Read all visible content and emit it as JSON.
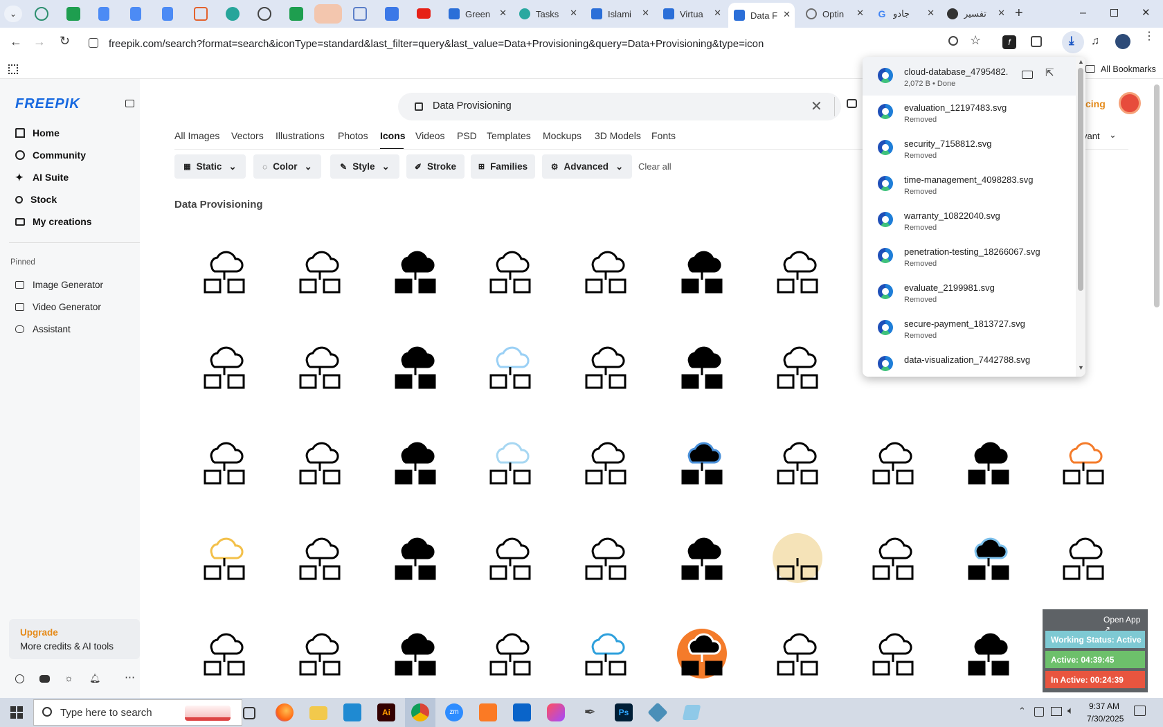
{
  "browser": {
    "tabs": [
      {
        "label": "Green",
        "color": "#2b6fd8"
      },
      {
        "label": "Tasks",
        "color": "#2aa8a0"
      },
      {
        "label": "Islami",
        "color": "#2b6fd8"
      },
      {
        "label": "Virtua",
        "color": "#2b6fd8"
      },
      {
        "label": "Data F",
        "color": "#2b6fd8",
        "active": true
      },
      {
        "label": "Optin",
        "color": "#6d6d6d"
      },
      {
        "label": "جادو",
        "color": "#4285f4"
      },
      {
        "label": "تفسير",
        "color": "#333333"
      }
    ],
    "url": "freepik.com/search?format=search&iconType=standard&last_filter=query&last_value=Data+Provisioning&query=Data+Provisioning&type=icon",
    "all_bookmarks": "All Bookmarks"
  },
  "sidebar": {
    "logo": "FREEPIK",
    "nav": [
      {
        "label": "Home",
        "icon": "home-icon"
      },
      {
        "label": "Community",
        "icon": "globe-icon"
      },
      {
        "label": "AI Suite",
        "icon": "sparkle-icon"
      },
      {
        "label": "Stock",
        "icon": "search-icon"
      },
      {
        "label": "My creations",
        "icon": "folder-icon"
      }
    ],
    "pinned_title": "Pinned",
    "pinned": [
      {
        "label": "Image Generator"
      },
      {
        "label": "Video Generator"
      },
      {
        "label": "Assistant"
      }
    ],
    "upgrade": {
      "title": "Upgrade",
      "subtitle": "More credits & AI tools"
    }
  },
  "search": {
    "value": "Data Provisioning",
    "pricing_fragment": "cing",
    "sort_fragment": "vant"
  },
  "type_tabs": [
    "All Images",
    "Vectors",
    "Illustrations",
    "Photos",
    "Icons",
    "Videos",
    "PSD",
    "Templates",
    "Mockups",
    "3D Models",
    "Fonts"
  ],
  "active_type_tab": "Icons",
  "filters": [
    {
      "label": "Static"
    },
    {
      "label": "Color"
    },
    {
      "label": "Style"
    },
    {
      "label": "Stroke"
    },
    {
      "label": "Families"
    },
    {
      "label": "Advanced"
    }
  ],
  "clear_all": "Clear all",
  "results_title": "Data Provisioning",
  "downloads": [
    {
      "name": "cloud-database_4795482.",
      "status": "2,072 B • Done"
    },
    {
      "name": "evaluation_12197483.svg",
      "status": "Removed"
    },
    {
      "name": "security_7158812.svg",
      "status": "Removed"
    },
    {
      "name": "time-management_4098283.svg",
      "status": "Removed"
    },
    {
      "name": "warranty_10822040.svg",
      "status": "Removed"
    },
    {
      "name": "penetration-testing_18266067.svg",
      "status": "Removed"
    },
    {
      "name": "evaluate_2199981.svg",
      "status": "Removed"
    },
    {
      "name": "secure-payment_1813727.svg",
      "status": "Removed"
    },
    {
      "name": "data-visualization_7442788.svg",
      "status": ""
    }
  ],
  "widget": {
    "open_app": "Open App ↗",
    "working": "Working Status: Active",
    "active": "Active: 04:39:45",
    "inactive": "In Active: 00:24:39"
  },
  "taskbar": {
    "search_placeholder": "Type here to search",
    "time": "9:37 AM",
    "date": "7/30/2025"
  }
}
